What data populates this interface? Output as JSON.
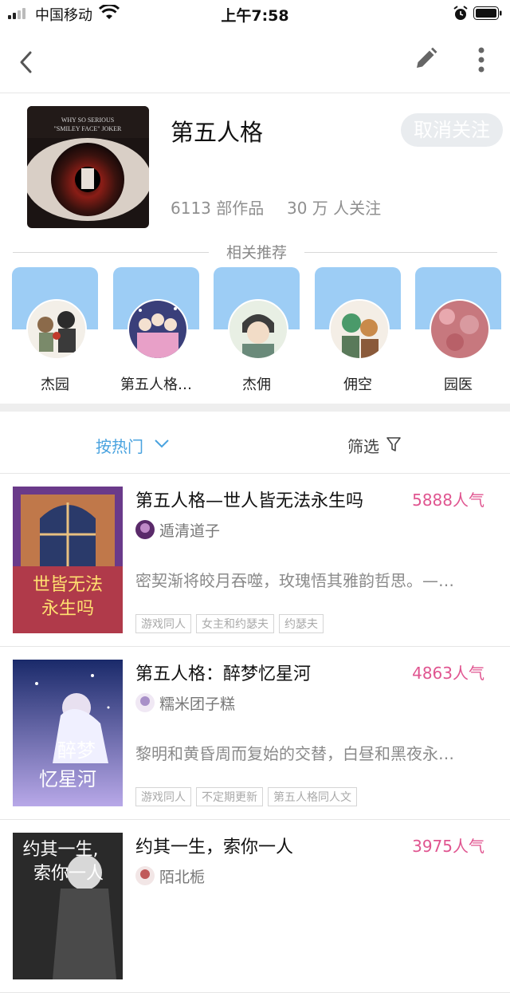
{
  "status_bar": {
    "carrier": "中国移动",
    "time": "上午7:58"
  },
  "topic": {
    "title": "第五人格",
    "follow_button": "取消关注",
    "works": "6113 部作品",
    "followers": "30 万 人关注"
  },
  "related": {
    "title": "相关推荐",
    "items": [
      {
        "label": "杰园"
      },
      {
        "label": "第五人格…"
      },
      {
        "label": "杰佣"
      },
      {
        "label": "佣空"
      },
      {
        "label": "园医"
      }
    ]
  },
  "sort": {
    "hot_label": "按热门",
    "filter_label": "筛选"
  },
  "books": [
    {
      "title": "第五人格—世人皆无法永生吗",
      "popularity": "5888人气",
      "author": "遁清道子",
      "description": "密契渐将皎月吞噬，玫瑰悟其雅韵哲思。—…",
      "tags": [
        "游戏同人",
        "女主和约瑟夫",
        "约瑟夫"
      ]
    },
    {
      "title": "第五人格：醉梦忆星河",
      "popularity": "4863人气",
      "author": "糯米团子糕",
      "description": "黎明和黄昏周而复始的交替，白昼和黑夜永…",
      "tags": [
        "游戏同人",
        "不定期更新",
        "第五人格同人文"
      ]
    },
    {
      "title": "约其一生，索你一人",
      "popularity": "3975人气",
      "author": "陌北栀",
      "description": "",
      "tags": []
    }
  ],
  "colors": {
    "accent_blue": "#4aa3df",
    "popularity_pink": "#e05590",
    "banner_blue": "#9dcdf5"
  }
}
